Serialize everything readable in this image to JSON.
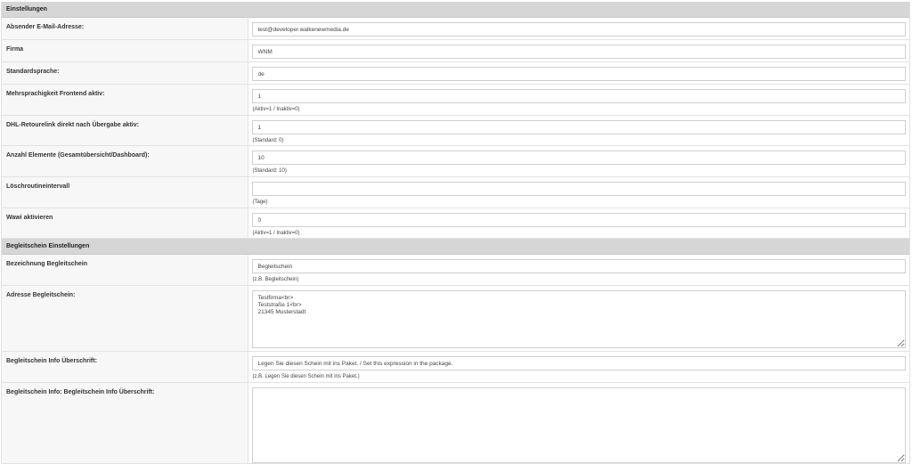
{
  "sections": {
    "settings": "Einstellungen",
    "packing_slip": "Begleitschein Einstellungen"
  },
  "fields": {
    "sender_email": {
      "label": "Absender E-Mail-Adresse:",
      "value": "test@developer.walkenewmedia.de"
    },
    "company": {
      "label": "Firma",
      "value": "WNM"
    },
    "default_language": {
      "label": "Standardsprache:",
      "value": "de"
    },
    "multilang_frontend": {
      "label": "Mehrsprachigkeit Frontend aktiv:",
      "value": "1",
      "hint": "(Aktiv=1 / Inaktiv=0)"
    },
    "dhl_return_link": {
      "label": "DHL-Retourelink direkt nach Übergabe aktiv:",
      "value": "1",
      "hint": "(Standard: 0)"
    },
    "item_count": {
      "label": "Anzahl Elemente (Gesamtübersicht/Dashboard):",
      "value": "10",
      "hint": "(Standard: 10)"
    },
    "delete_interval": {
      "label": "Löschroutineintervall",
      "value": "",
      "hint": "(Tage)"
    },
    "wawi_active": {
      "label": "Wawi aktivieren",
      "value": "0",
      "hint": "(Aktiv=1 / Inaktiv=0)"
    },
    "slip_name": {
      "label": "Bezeichnung Begleitschein",
      "value": "Begleitschein",
      "hint": "(z.B. Begleitschein)"
    },
    "slip_address": {
      "label": "Adresse Begleitschein:",
      "value": "Testfirma<br>\nTeststraße 1<br>\n21345 Musterstadt"
    },
    "slip_info_heading": {
      "label": "Begleitschein Info Überschrift:",
      "value": "Legen Sie diesen Schein mit ins Paket. / Set this expression in the package.",
      "hint": "(z.B. Legen Sie diesen Schein mit ins Paket.)"
    },
    "slip_info_text": {
      "label": "Begleitschein Info: Begleitschein Info Überschrift:",
      "value": ""
    }
  }
}
